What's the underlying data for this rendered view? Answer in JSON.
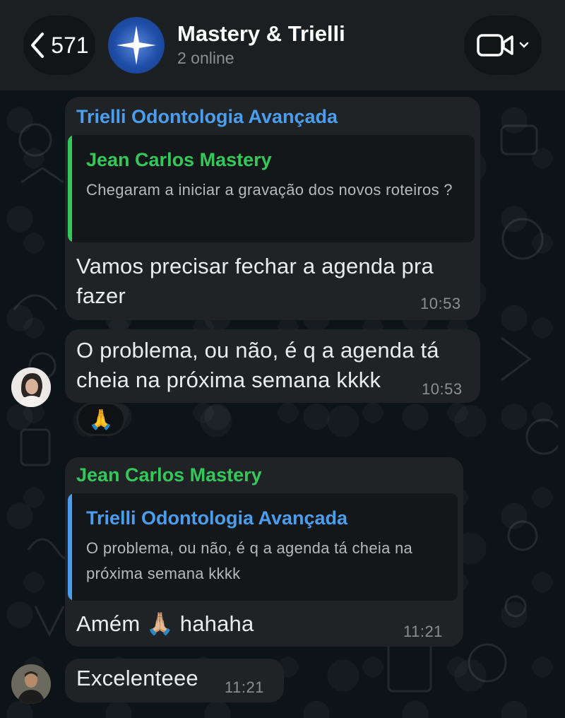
{
  "header": {
    "back_count": "571",
    "title": "Mastery & Trielli",
    "subtitle": "2 online",
    "back_icon": "chevron-left-icon",
    "video_icon": "video-camera-icon"
  },
  "colors": {
    "name_blue": "#4a9eed",
    "name_green": "#34c759",
    "bubble": "#1f2326",
    "quote_bg": "#141719"
  },
  "messages": [
    {
      "sender": "Trielli Odontologia Avançada",
      "reply_to": {
        "name": "Jean Carlos Mastery",
        "text": "Chegaram a iniciar a gravação dos novos roteiros ?"
      },
      "text": "Vamos precisar fechar a agenda pra fazer",
      "time": "10:53"
    },
    {
      "text": "O problema, ou não, é q a agenda tá cheia na próxima semana kkkk",
      "time": "10:53",
      "reaction": "🙏"
    },
    {
      "sender": "Jean Carlos Mastery",
      "reply_to": {
        "name": "Trielli Odontologia Avançada",
        "text": "O problema, ou não, é q a agenda tá cheia na próxima semana kkkk"
      },
      "text": "Amém 🙏🏼 hahaha",
      "time": "11:21"
    },
    {
      "text": "Excelenteee",
      "time": "11:21"
    }
  ]
}
